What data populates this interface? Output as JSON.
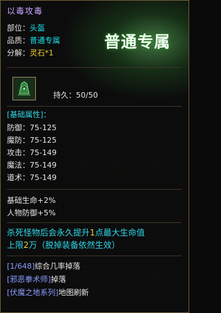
{
  "item": {
    "name": "以毒攻毒",
    "slot_label": "部位：",
    "slot_value": "头盔",
    "quality_label": "品质：",
    "quality_value": "普通专属",
    "decompose_label": "分解：",
    "decompose_value": "灵石*1",
    "badge_text": "普通专属",
    "durability_label": "持久：",
    "durability_value": "50/50"
  },
  "base_attrs": {
    "header": "[基础属性]：",
    "rows": [
      {
        "label": "防御：",
        "value": "75-125"
      },
      {
        "label": "魔防：",
        "value": "75-125"
      },
      {
        "label": "攻击：",
        "value": "75-149"
      },
      {
        "label": "魔法：",
        "value": "75-149"
      },
      {
        "label": "道术：",
        "value": "75-149"
      }
    ]
  },
  "bonus": {
    "line1": "基础生命+2%",
    "line2": "人物防御+5%"
  },
  "special": {
    "line1_a": "杀死怪物后会永久提升",
    "line1_b": "1",
    "line1_c": "点最大生命值",
    "line2_a": "上限",
    "line2_b": "2",
    "line2_c": "万（脱掉装备依然生效）"
  },
  "drops": {
    "line1_link": "[1/648]",
    "line1_text": "综合几率掉落",
    "line2_link": "[邪恶拳术师]",
    "line2_text": "掉落",
    "line3_link": "[伏魔之地系列]",
    "line3_text": "地图刷新"
  },
  "colors": {
    "title": "#c9a3ff",
    "value_cyan": "#19e0e6",
    "value_yellow": "#f2d22a",
    "border": "#6e5b39"
  }
}
